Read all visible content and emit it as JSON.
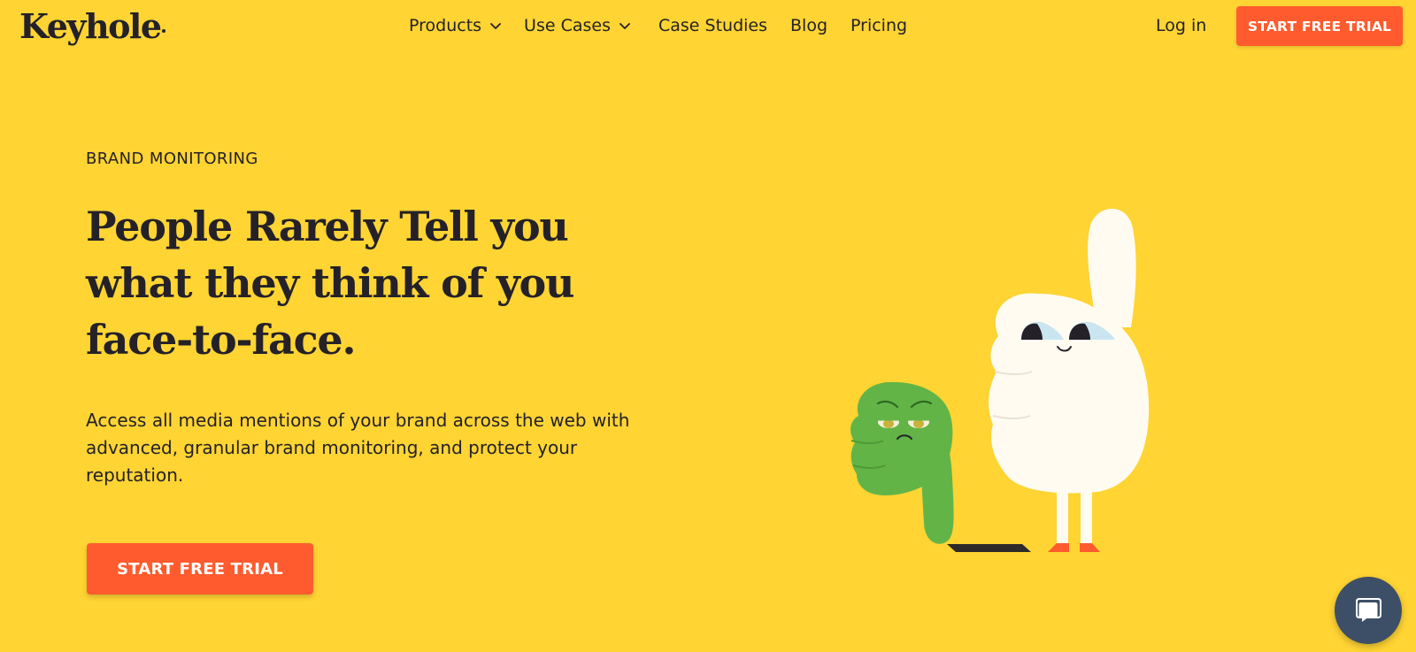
{
  "header": {
    "logo": "Keyhole",
    "nav": [
      {
        "label": "Products",
        "has_dropdown": true
      },
      {
        "label": "Use Cases",
        "has_dropdown": true
      },
      {
        "label": "Case Studies",
        "has_dropdown": false
      },
      {
        "label": "Blog",
        "has_dropdown": false
      },
      {
        "label": "Pricing",
        "has_dropdown": false
      }
    ],
    "login": "Log in",
    "cta": "START FREE TRIAL"
  },
  "hero": {
    "eyebrow": "BRAND MONITORING",
    "headline_lines": [
      "People Rarely Tell you",
      "what they think of you",
      "face-to-face."
    ],
    "description_lines": [
      "Access all media mentions of your brand across the web with",
      "advanced, granular brand monitoring, and protect your",
      "reputation."
    ],
    "cta": "START FREE TRIAL"
  },
  "colors": {
    "background": "#FFD433",
    "accent": "#FF5B2E",
    "text": "#242129",
    "chat": "#3D4F66"
  },
  "icons": {
    "chevron": "chevron-down-icon",
    "chat": "chat-bubble-icon"
  }
}
